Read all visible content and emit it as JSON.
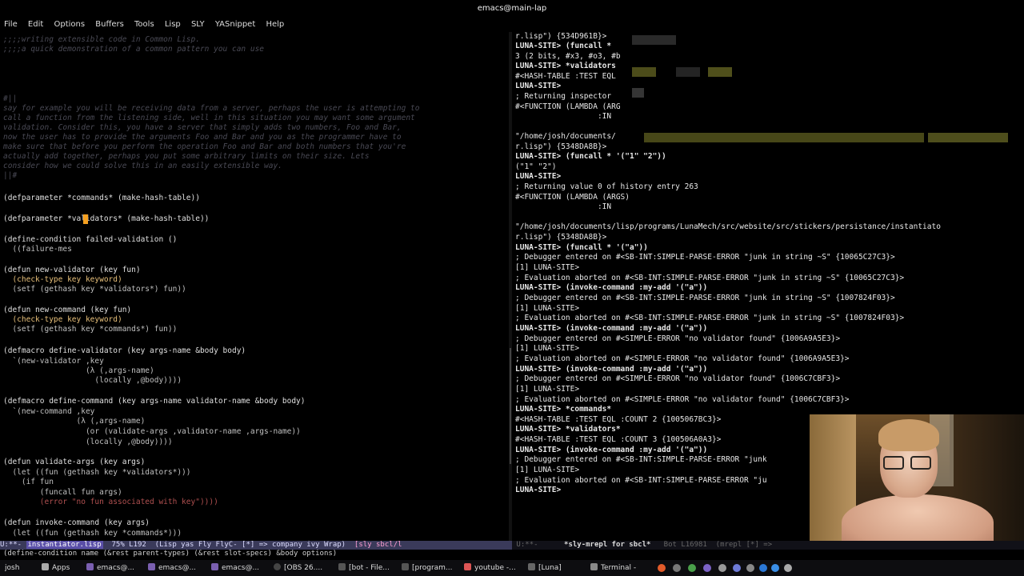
{
  "window": {
    "title": "emacs@main-lap"
  },
  "menu": [
    "File",
    "Edit",
    "Options",
    "Buffers",
    "Tools",
    "Lisp",
    "SLY",
    "YASnippet",
    "Help"
  ],
  "editor": {
    "lines": [
      {
        "cls": "c-comment",
        "text": ";;;;writing extensible code in Common Lisp."
      },
      {
        "cls": "c-comment",
        "text": ";;;;a quick demonstration of a common pattern you can use"
      },
      {
        "cls": "c-comment",
        "text": "#||"
      },
      {
        "cls": "c-comment",
        "text": "say for example you will be receiving data from a server, perhaps the user is attempting to"
      },
      {
        "cls": "c-comment",
        "text": "call a function from the listening side, well in this situation you may want some argument"
      },
      {
        "cls": "c-comment",
        "text": "validation. Consider this, you have a server that simply adds two numbers, Foo and Bar,"
      },
      {
        "cls": "c-comment",
        "text": "now the user has to provide the arguments Foo and Bar and you as the programmer have to"
      },
      {
        "cls": "c-comment",
        "text": "make sure that before you perform the operation Foo and Bar and both numbers that you're"
      },
      {
        "cls": "c-comment",
        "text": "actually add together, perhaps you put some arbitrary limits on their size. Lets"
      },
      {
        "cls": "c-comment",
        "text": "consider how we could solve this in an easily extensible way."
      },
      {
        "cls": "c-comment",
        "text": "||#"
      },
      {
        "cls": "c-def",
        "text": "(defparameter *commands* (make-hash-table))"
      },
      {
        "cls": "c-def",
        "text": "(defparameter *validators* (make-hash-table))"
      },
      {
        "cls": "c-def",
        "text": "(define-condition failed-validation ()"
      },
      {
        "cls": "c-var",
        "text": "  ((failure-mes"
      },
      {
        "cls": "c-def",
        "text": "(defun new-validator (key fun)"
      },
      {
        "cls": "c-kw",
        "text": "  (check-type key keyword)"
      },
      {
        "cls": "c-var",
        "text": "  (setf (gethash key *validators*) fun))"
      },
      {
        "cls": "c-def",
        "text": "(defun new-command (key fun)"
      },
      {
        "cls": "c-kw",
        "text": "  (check-type key keyword)"
      },
      {
        "cls": "c-var",
        "text": "  (setf (gethash key *commands*) fun))"
      },
      {
        "cls": "c-def",
        "text": "(defmacro define-validator (key args-name &body body)"
      },
      {
        "cls": "c-var",
        "text": "  `(new-validator ,key"
      },
      {
        "cls": "c-var",
        "text": "                  (λ (,args-name)"
      },
      {
        "cls": "c-var",
        "text": "                    (locally ,@body))))"
      },
      {
        "cls": "c-def",
        "text": "(defmacro define-command (key args-name validator-name &body body)"
      },
      {
        "cls": "c-var",
        "text": "  `(new-command ,key"
      },
      {
        "cls": "c-var",
        "text": "                (λ (,args-name)"
      },
      {
        "cls": "c-var",
        "text": "                  (or (validate-args ,validator-name ,args-name))"
      },
      {
        "cls": "c-var",
        "text": "                  (locally ,@body))))"
      },
      {
        "cls": "c-def",
        "text": "(defun validate-args (key args)"
      },
      {
        "cls": "c-var",
        "text": "  (let ((fun (gethash key *validators*)))"
      },
      {
        "cls": "c-var",
        "text": "    (if fun"
      },
      {
        "cls": "c-var",
        "text": "        (funcall fun args)"
      },
      {
        "cls": "c-str",
        "text": "        (error \"no fun associated with key\"))))"
      },
      {
        "cls": "c-def",
        "text": "(defun invoke-command (key args)"
      },
      {
        "cls": "c-var",
        "text": "  (let ((fun (gethash key *commands*)))"
      }
    ]
  },
  "repl": {
    "lines": [
      {
        "cls": "c-out",
        "text": "r.lisp\") {534D961B}>"
      },
      {
        "cls": "c-prompt",
        "text": "LUNA-SITE> (funcall *"
      },
      {
        "cls": "c-out",
        "text": "3 (2 bits, #x3, #o3, #b"
      },
      {
        "cls": "c-prompt",
        "text": "LUNA-SITE> *validators"
      },
      {
        "cls": "c-out",
        "text": "#<HASH-TABLE :TEST EQL"
      },
      {
        "cls": "c-prompt",
        "text": "LUNA-SITE>"
      },
      {
        "cls": "c-out",
        "text": "; Returning inspector"
      },
      {
        "cls": "c-out",
        "text": "#<FUNCTION (LAMBDA (ARG"
      },
      {
        "cls": "c-out",
        "text": "                  :IN"
      },
      {
        "cls": "c-out",
        "text": ""
      },
      {
        "cls": "c-out",
        "text": "\"/home/josh/documents/"
      },
      {
        "cls": "c-out",
        "text": "r.lisp\") {5348DA8B}>"
      },
      {
        "cls": "c-prompt",
        "text": "LUNA-SITE> (funcall * '(\"1\" \"2\"))"
      },
      {
        "cls": "c-out",
        "text": "(\"1\" \"2\")"
      },
      {
        "cls": "c-prompt",
        "text": "LUNA-SITE>"
      },
      {
        "cls": "c-out",
        "text": "; Returning value 0 of history entry 263"
      },
      {
        "cls": "c-out",
        "text": "#<FUNCTION (LAMBDA (ARGS)"
      },
      {
        "cls": "c-out",
        "text": "                  :IN"
      },
      {
        "cls": "c-out",
        "text": ""
      },
      {
        "cls": "c-out",
        "text": "\"/home/josh/documents/lisp/programs/LunaMech/src/website/src/stickers/persistance/instantiato"
      },
      {
        "cls": "c-out",
        "text": "r.lisp\") {5348DA8B}>"
      },
      {
        "cls": "c-prompt",
        "text": "LUNA-SITE> (funcall * '(\"a\"))"
      },
      {
        "cls": "c-out",
        "text": "; Debugger entered on #<SB-INT:SIMPLE-PARSE-ERROR \"junk in string ~S\" {10065C27C3}>"
      },
      {
        "cls": "c-out",
        "text": "[1] LUNA-SITE>"
      },
      {
        "cls": "c-out",
        "text": "; Evaluation aborted on #<SB-INT:SIMPLE-PARSE-ERROR \"junk in string ~S\" {10065C27C3}>"
      },
      {
        "cls": "c-prompt",
        "text": "LUNA-SITE> (invoke-command :my-add '(\"a\"))"
      },
      {
        "cls": "c-out",
        "text": "; Debugger entered on #<SB-INT:SIMPLE-PARSE-ERROR \"junk in string ~S\" {1007824F03}>"
      },
      {
        "cls": "c-out",
        "text": "[1] LUNA-SITE>"
      },
      {
        "cls": "c-out",
        "text": "; Evaluation aborted on #<SB-INT:SIMPLE-PARSE-ERROR \"junk in string ~S\" {1007824F03}>"
      },
      {
        "cls": "c-prompt",
        "text": "LUNA-SITE> (invoke-command :my-add '(\"a\"))"
      },
      {
        "cls": "c-out",
        "text": "; Debugger entered on #<SIMPLE-ERROR \"no validator found\" {1006A9A5E3}>"
      },
      {
        "cls": "c-out",
        "text": "[1] LUNA-SITE>"
      },
      {
        "cls": "c-out",
        "text": "; Evaluation aborted on #<SIMPLE-ERROR \"no validator found\" {1006A9A5E3}>"
      },
      {
        "cls": "c-prompt",
        "text": "LUNA-SITE> (invoke-command :my-add '(\"a\"))"
      },
      {
        "cls": "c-out",
        "text": "; Debugger entered on #<SIMPLE-ERROR \"no validator found\" {1006C7CBF3}>"
      },
      {
        "cls": "c-out",
        "text": "[1] LUNA-SITE>"
      },
      {
        "cls": "c-out",
        "text": "; Evaluation aborted on #<SIMPLE-ERROR \"no validator found\" {1006C7CBF3}>"
      },
      {
        "cls": "c-prompt",
        "text": "LUNA-SITE> *commands*"
      },
      {
        "cls": "c-out",
        "text": "#<HASH-TABLE :TEST EQL :COUNT 2 {1005067BC3}>"
      },
      {
        "cls": "c-prompt",
        "text": "LUNA-SITE> *validators*"
      },
      {
        "cls": "c-out",
        "text": "#<HASH-TABLE :TEST EQL :COUNT 3 {100506A0A3}>"
      },
      {
        "cls": "c-prompt",
        "text": "LUNA-SITE> (invoke-command :my-add '(\"a\"))"
      },
      {
        "cls": "c-out",
        "text": "; Debugger entered on #<SB-INT:SIMPLE-PARSE-ERROR \"junk"
      },
      {
        "cls": "c-out",
        "text": "[1] LUNA-SITE>"
      },
      {
        "cls": "c-out",
        "text": "; Evaluation aborted on #<SB-INT:SIMPLE-PARSE-ERROR \"ju"
      },
      {
        "cls": "c-prompt",
        "text": "LUNA-SITE>"
      }
    ]
  },
  "modeline": {
    "left_state": "U:**-",
    "left_buffer": "instantiator.lisp",
    "left_info": "  75% L192  (Lisp yas Fly FlyC- [*] => company ivy Wrap)  ",
    "left_sly": "[sly sbcl/l",
    "right_state": "U:**-",
    "right_buffer": "*sly-mrepl for sbcl*",
    "right_info": "   Bot L16981  (mrepl [*] =>"
  },
  "echo": "(define-condition name (&rest parent-types) (&rest slot-specs) &body options)",
  "taskbar": {
    "user": "josh",
    "items": [
      "Apps",
      "emacs@...",
      "emacs@...",
      "emacs@...",
      "[OBS 26....",
      "[bot - File...",
      "[program...",
      "youtube -...",
      "[Luna]",
      "Terminal -"
    ]
  },
  "colors": {
    "modeline_active": "#3a3a5a",
    "cursor": "#f5a020",
    "prompt": "#e8e8e8",
    "repl_input": "#b080d8"
  }
}
